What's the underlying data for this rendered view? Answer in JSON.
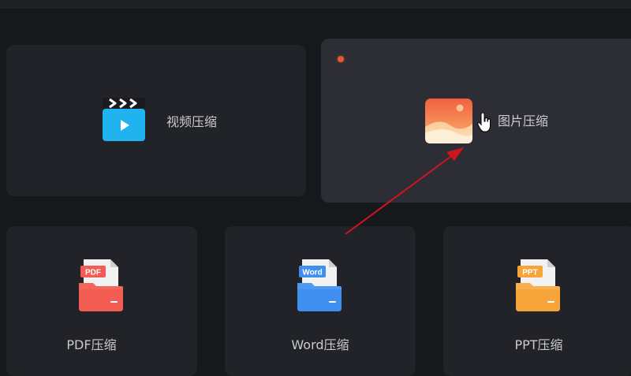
{
  "cards": {
    "video": {
      "label": "视频压缩",
      "icon": "video-clapper-icon"
    },
    "image": {
      "label": "图片压缩",
      "icon": "image-landscape-icon"
    },
    "pdf": {
      "label": "PDF压缩",
      "badge": "PDF",
      "icon": "pdf-folder-icon"
    },
    "word": {
      "label": "Word压缩",
      "badge": "Word",
      "icon": "word-folder-icon"
    },
    "ppt": {
      "label": "PPT压缩",
      "badge": "PPT",
      "icon": "ppt-folder-icon"
    }
  },
  "colors": {
    "background": "#17181c",
    "card": "#222328",
    "card_hover": "#2c2d35",
    "annotation_arrow": "#d0161d",
    "pdf": "#f25c52",
    "word": "#3f8ff0",
    "ppt": "#f7a53a"
  }
}
